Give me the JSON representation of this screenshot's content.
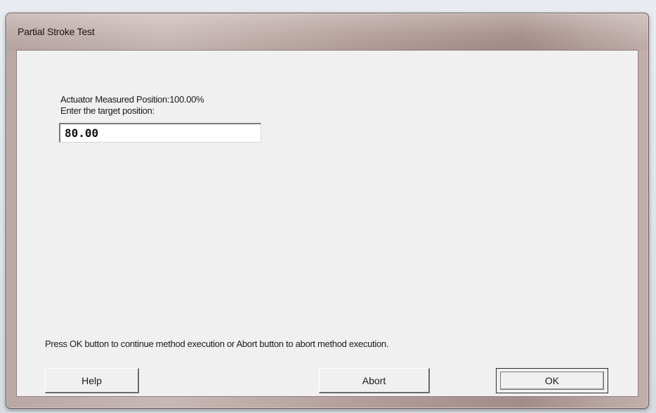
{
  "window": {
    "title": "Partial Stroke Test"
  },
  "content": {
    "measured_position_line": "Actuator Measured Position:100.00%",
    "prompt_line": "Enter the target position:",
    "target_value": "80.00",
    "instructions": "Press OK button to continue method execution or Abort button to abort method execution."
  },
  "buttons": {
    "help_label": "Help",
    "abort_label": "Abort",
    "ok_label": "OK"
  }
}
